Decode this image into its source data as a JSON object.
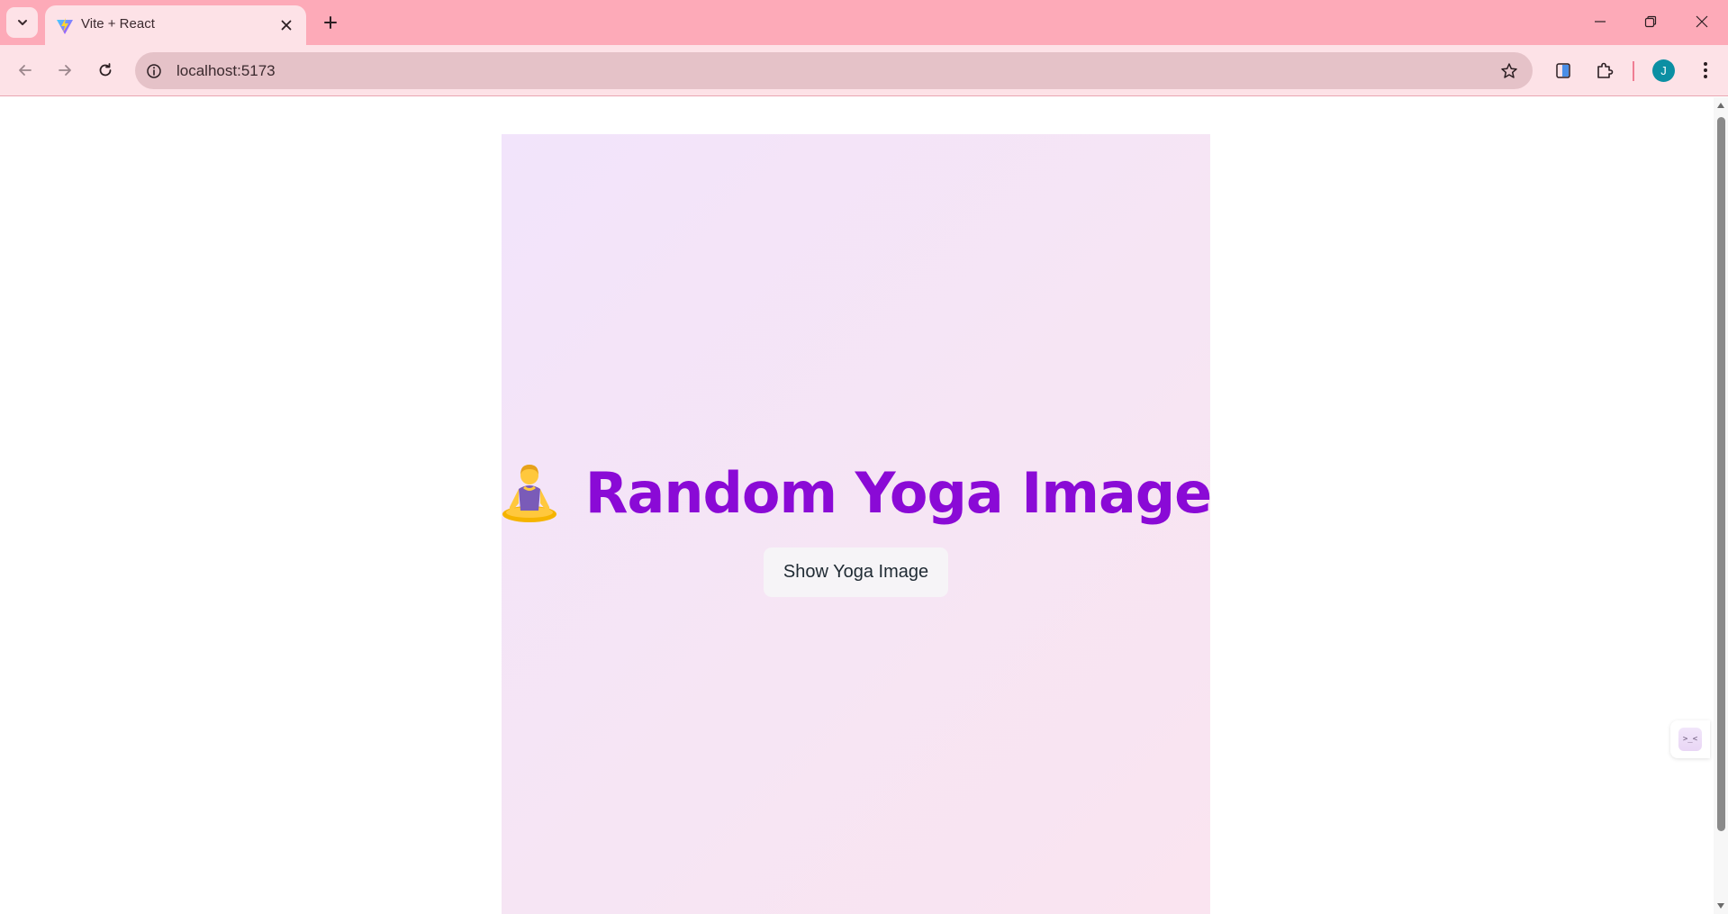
{
  "browser": {
    "tab": {
      "title": "Vite + React",
      "favicon": "vite-logo-icon"
    },
    "address_bar": {
      "url": "localhost:5173"
    },
    "profile_initial": "J",
    "colors": {
      "tabstrip": "#fdaab8",
      "toolbar": "#fde2e7",
      "omnibox": "#e5c2c8",
      "avatar": "#0b8fa3"
    }
  },
  "page": {
    "heading": {
      "emoji": "person-in-lotus-position-icon",
      "text": "Random Yoga Image"
    },
    "button": {
      "label": "Show Yoga Image"
    },
    "colors": {
      "heading": "#8a0ad6",
      "card_gradient_start": "#f2e4fb",
      "card_gradient_end": "#fae4f0"
    }
  },
  "floating_widget": {
    "label": ">_<"
  }
}
